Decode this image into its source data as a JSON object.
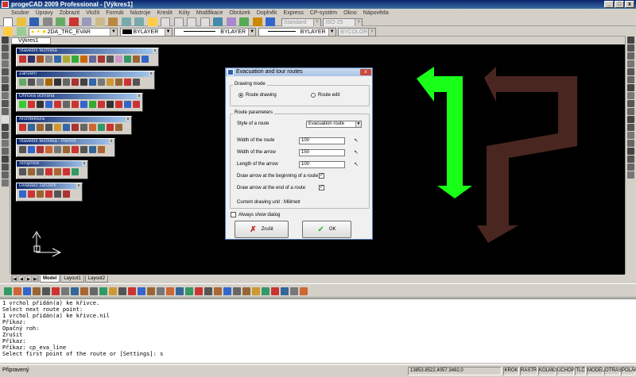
{
  "app": {
    "title": "progeCAD 2009 Professional - [Výkres1]",
    "window_controls": [
      "_",
      "□",
      "x"
    ]
  },
  "menu": [
    "Soubor",
    "Úpravy",
    "Zobrazit",
    "Vložit",
    "Formát",
    "Nástroje",
    "Kreslit",
    "Kóty",
    "Modifikace",
    "Obrázek",
    "Doplněk",
    "Express",
    "CP-systém",
    "Okno",
    "Nápověda"
  ],
  "toolbar": {
    "text_style": "Standard",
    "dim_style": "ISO-25",
    "layer": "2DA_TRC_EVAR",
    "color": "BYLAYER",
    "linetype": "BYLAYER",
    "lineweight": "BYLAYER",
    "plotstyle": "BYCOLOR"
  },
  "document_tab": "Výkres1",
  "palettes": [
    {
      "title": "Stavební technika"
    },
    {
      "title": "Zařízení"
    },
    {
      "title": "Ohňová ochrana"
    },
    {
      "title": "Architektura"
    },
    {
      "title": "Stavební technika - měření"
    },
    {
      "title": "Stropnice"
    },
    {
      "title": "Ovládací zařízení"
    }
  ],
  "dialog": {
    "title": "Evacuation and tour routes",
    "drawing_mode_label": "Drawing mode",
    "radio_route_drawing": "Route drawing",
    "radio_route_edit": "Route edit",
    "route_parameters_label": "Route parameters",
    "style_label": "Style of a route",
    "style_value": "Evacuation route",
    "width_route_label": "Width of the route",
    "width_route_value": "100",
    "width_arrow_label": "Width of the arrow",
    "width_arrow_value": "150",
    "length_arrow_label": "Length of the arrow",
    "length_arrow_value": "100",
    "arrow_begin_label": "Draw arrow at the beginning of a route",
    "arrow_begin_checked": true,
    "arrow_end_label": "Draw arrow at the end of a route",
    "arrow_end_checked": true,
    "unit_text": "Current drawing unit : Milimetr",
    "always_show_label": "Always show dialog",
    "always_show_checked": false,
    "cancel_label": "Zrušit",
    "ok_label": "OK"
  },
  "layout_tabs": [
    "Model",
    "Layout1",
    "Layout2"
  ],
  "active_layout": "Model",
  "command_lines": [
    "1 vrchol přidán(a) ke křivce.",
    "Select next route point:",
    "1 vrchol přidán(a) ke křivce.nil",
    "Příkaz:",
    "Opačný roh:",
    "Zrušit",
    "Příkaz:",
    "Příkaz: cp_eva_line",
    "Select first point of the route or [Settings]: s"
  ],
  "status": {
    "text": "Připravený",
    "coords": "13853.8522,4057.3492,0",
    "toggles": [
      "KROK",
      "RASTR",
      "KOLMO",
      "UCHOP",
      "TLČ",
      "MODEL",
      "OTRAS",
      "POLÁR"
    ]
  },
  "colors": {
    "canvas": "#000000",
    "green_arrow": "#19ff19",
    "brown_arrow": "#4a2620"
  }
}
